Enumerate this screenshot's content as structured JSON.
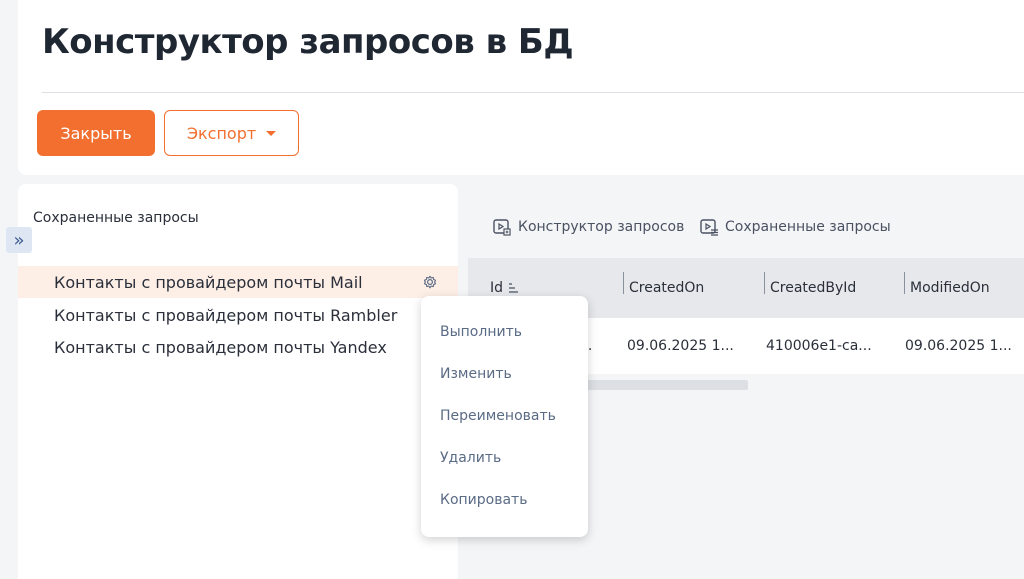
{
  "header": {
    "title": "Конструктор запросов в БД",
    "close_label": "Закрыть",
    "export_label": "Экспорт"
  },
  "sidebar": {
    "title": "Сохраненные запросы",
    "items": [
      {
        "label": "Контакты с провайдером почты Mail",
        "active": true
      },
      {
        "label": "Контакты с провайдером почты Rambler",
        "active": false
      },
      {
        "label": "Контакты с провайдером почты Yandex",
        "active": false
      }
    ]
  },
  "tabs": [
    {
      "label": "Конструктор запросов",
      "icon": "query-builder-icon"
    },
    {
      "label": "Сохраненные запросы",
      "icon": "saved-queries-icon"
    }
  ],
  "table": {
    "columns": [
      "Id",
      "CreatedOn",
      "CreatedById",
      "ModifiedOn"
    ],
    "rows": [
      [
        "...",
        "09.06.2025 1...",
        "410006e1-ca...",
        "09.06.2025 1..."
      ]
    ]
  },
  "context_menu": {
    "items": [
      "Выполнить",
      "Изменить",
      "Переименовать",
      "Удалить",
      "Копировать"
    ]
  },
  "colors": {
    "accent": "#f26f2f",
    "active_row": "#fdeee6",
    "menu_text": "#5a6b85"
  }
}
